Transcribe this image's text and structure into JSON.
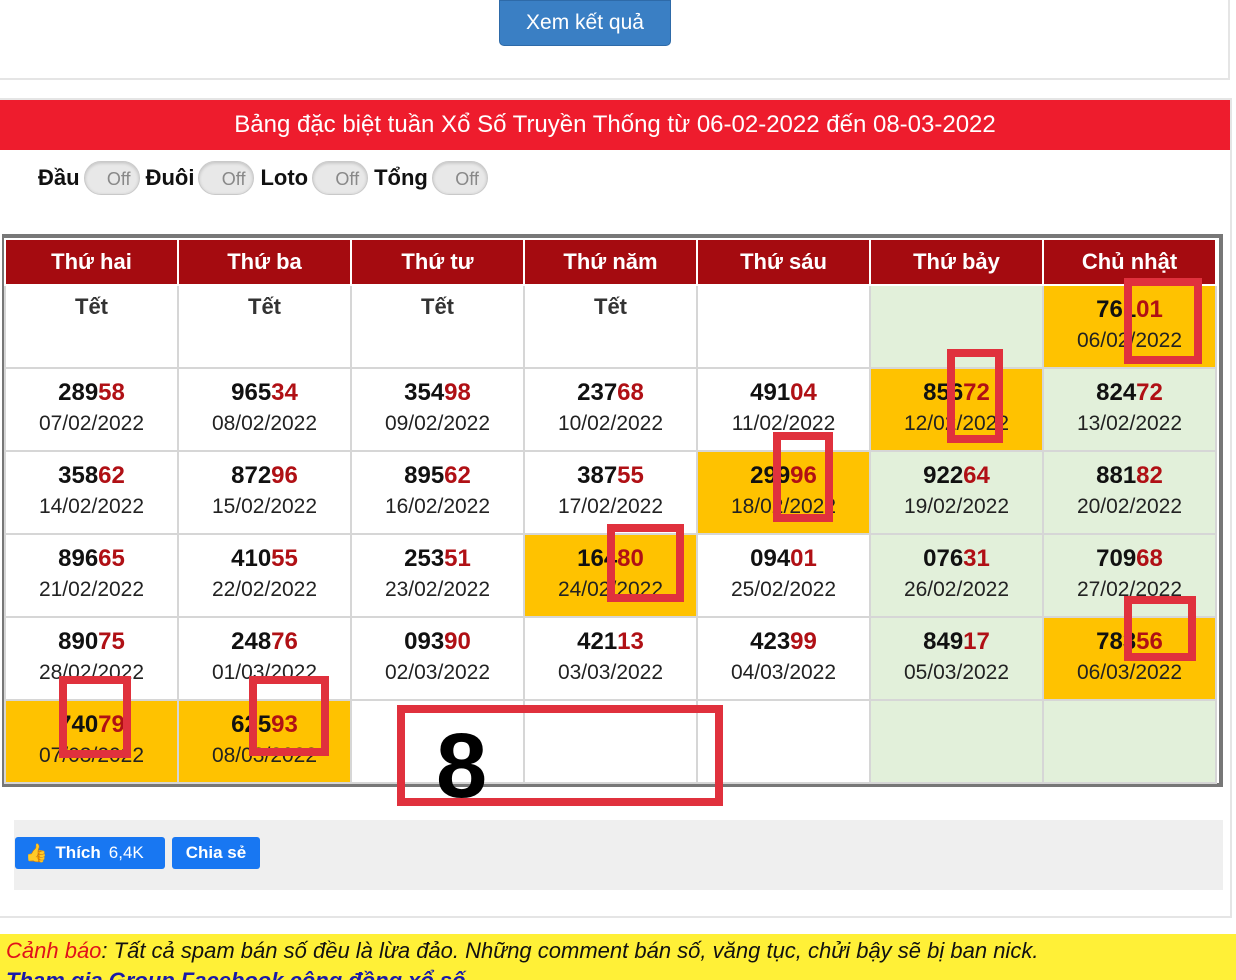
{
  "top": {
    "button_label": "Xem kết quả"
  },
  "title": "Bảng đặc biệt tuần Xổ Số Truyền Thống từ 06-02-2022 đến 08-03-2022",
  "toggles": [
    {
      "label": "Đầu",
      "state": "Off"
    },
    {
      "label": "Đuôi",
      "state": "Off"
    },
    {
      "label": "Loto",
      "state": "Off"
    },
    {
      "label": "Tổng",
      "state": "Off"
    }
  ],
  "weekdays": [
    "Thứ hai",
    "Thứ ba",
    "Thứ tư",
    "Thứ năm",
    "Thứ sáu",
    "Thứ bảy",
    "Chủ nhật"
  ],
  "rows": [
    [
      {
        "tet": "Tết"
      },
      {
        "tet": "Tết"
      },
      {
        "tet": "Tết"
      },
      {
        "tet": "Tết"
      },
      {},
      {
        "bg": "green"
      },
      {
        "head": "761",
        "tail": "01",
        "date": "06/02/2022",
        "bg": "gold"
      }
    ],
    [
      {
        "head": "289",
        "tail": "58",
        "date": "07/02/2022"
      },
      {
        "head": "965",
        "tail": "34",
        "date": "08/02/2022"
      },
      {
        "head": "354",
        "tail": "98",
        "date": "09/02/2022"
      },
      {
        "head": "237",
        "tail": "68",
        "date": "10/02/2022"
      },
      {
        "head": "491",
        "tail": "04",
        "date": "11/02/2022"
      },
      {
        "head": "856",
        "tail": "72",
        "date": "12/02/2022",
        "bg": "gold"
      },
      {
        "head": "824",
        "tail": "72",
        "date": "13/02/2022",
        "bg": "green"
      }
    ],
    [
      {
        "head": "358",
        "tail": "62",
        "date": "14/02/2022"
      },
      {
        "head": "872",
        "tail": "96",
        "date": "15/02/2022"
      },
      {
        "head": "895",
        "tail": "62",
        "date": "16/02/2022"
      },
      {
        "head": "387",
        "tail": "55",
        "date": "17/02/2022"
      },
      {
        "head": "299",
        "tail": "96",
        "date": "18/02/2022",
        "bg": "gold"
      },
      {
        "head": "922",
        "tail": "64",
        "date": "19/02/2022",
        "bg": "green"
      },
      {
        "head": "881",
        "tail": "82",
        "date": "20/02/2022",
        "bg": "green"
      }
    ],
    [
      {
        "head": "896",
        "tail": "65",
        "date": "21/02/2022"
      },
      {
        "head": "410",
        "tail": "55",
        "date": "22/02/2022"
      },
      {
        "head": "253",
        "tail": "51",
        "date": "23/02/2022"
      },
      {
        "head": "164",
        "tail": "80",
        "date": "24/02/2022",
        "bg": "gold"
      },
      {
        "head": "094",
        "tail": "01",
        "date": "25/02/2022"
      },
      {
        "head": "076",
        "tail": "31",
        "date": "26/02/2022",
        "bg": "green"
      },
      {
        "head": "709",
        "tail": "68",
        "date": "27/02/2022",
        "bg": "green"
      }
    ],
    [
      {
        "head": "890",
        "tail": "75",
        "date": "28/02/2022"
      },
      {
        "head": "248",
        "tail": "76",
        "date": "01/03/2022"
      },
      {
        "head": "093",
        "tail": "90",
        "date": "02/03/2022"
      },
      {
        "head": "421",
        "tail": "13",
        "date": "03/03/2022"
      },
      {
        "head": "423",
        "tail": "99",
        "date": "04/03/2022"
      },
      {
        "head": "849",
        "tail": "17",
        "date": "05/03/2022",
        "bg": "green"
      },
      {
        "head": "783",
        "tail": "56",
        "date": "06/03/2022",
        "bg": "gold"
      }
    ],
    [
      {
        "head": "740",
        "tail": "79",
        "date": "07/03/2022",
        "bg": "gold"
      },
      {
        "head": "625",
        "tail": "93",
        "date": "08/03/2022",
        "bg": "gold"
      },
      {},
      {},
      {},
      {
        "bg": "green"
      },
      {
        "bg": "green"
      }
    ]
  ],
  "annotation": {
    "big_number": "8",
    "color": "#e0313d"
  },
  "social": {
    "like_label": "Thích",
    "like_count": "6,4K",
    "share_label": "Chia sẻ"
  },
  "warning": {
    "prefix": "Cảnh báo",
    "text": ": Tất cả spam bán số đều là lừa đảo. Những comment bán số, văng tục, chửi bậy sẽ bị ban nick.",
    "line2": "Tham gia Group Facebook cộng đồng xổ số"
  },
  "colors": {
    "title_bar": "#ee1c2d",
    "header": "#a50b10",
    "highlight": "#ffc200",
    "weekend": "#e2f0da",
    "button": "#3a7fc4"
  }
}
